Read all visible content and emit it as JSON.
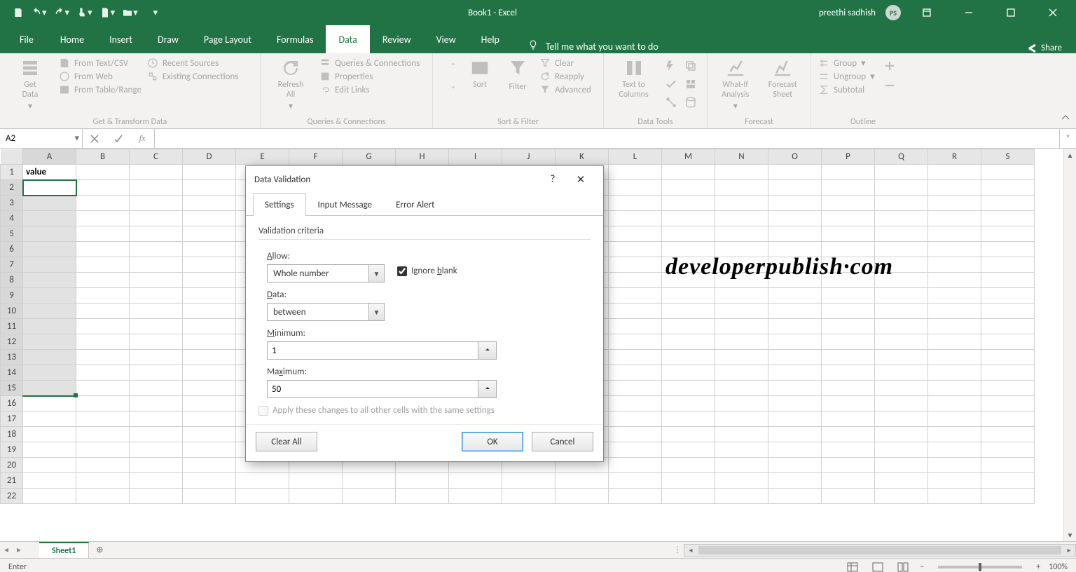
{
  "titlebar": {
    "doc": "Book1",
    "app": "Excel",
    "sep": "  -  ",
    "user": "preethi sadhish",
    "avatar": "PS"
  },
  "tabs": {
    "file": "File",
    "list": [
      "Home",
      "Insert",
      "Draw",
      "Page Layout",
      "Formulas",
      "Data",
      "Review",
      "View",
      "Help"
    ],
    "active": "Data",
    "tellme": "Tell me what you want to do",
    "share": "Share"
  },
  "ribbon": {
    "getdata": {
      "big": "Get\nData",
      "items": [
        "From Text/CSV",
        "From Web",
        "From Table/Range",
        "Recent Sources",
        "Existing Connections"
      ],
      "label": "Get & Transform Data"
    },
    "queries": {
      "big": "Refresh\nAll",
      "items": [
        "Queries & Connections",
        "Properties",
        "Edit Links"
      ],
      "label": "Queries & Connections"
    },
    "sortfilter": {
      "sort": "Sort",
      "filter": "Filter",
      "clear": "Clear",
      "reapply": "Reapply",
      "advanced": "Advanced",
      "label": "Sort & Filter"
    },
    "datatools": {
      "big": "Text to\nColumns",
      "label": "Data Tools"
    },
    "forecast": {
      "whatif": "What-If\nAnalysis",
      "sheet": "Forecast\nSheet",
      "label": "Forecast"
    },
    "outline": {
      "group": "Group",
      "ungroup": "Ungroup",
      "subtotal": "Subtotal",
      "label": "Outline"
    }
  },
  "fbar": {
    "name": "A2",
    "fx": "fx"
  },
  "grid": {
    "cols": [
      "A",
      "B",
      "C",
      "D",
      "E",
      "F",
      "G",
      "H",
      "I",
      "J",
      "K",
      "L",
      "M",
      "N",
      "O",
      "P",
      "Q",
      "R",
      "S"
    ],
    "rows": 22,
    "A1": "value",
    "sel_start": 2,
    "sel_end": 15,
    "watermark": "developerpublish·com"
  },
  "sheetbar": {
    "sheet": "Sheet1"
  },
  "status": {
    "mode": "Enter",
    "zoom": "100%"
  },
  "dialog": {
    "title": "Data Validation",
    "tabs": [
      "Settings",
      "Input Message",
      "Error Alert"
    ],
    "active_tab": "Settings",
    "section": "Validation criteria",
    "allow_label": "Allow:",
    "allow_value": "Whole number",
    "ignore": "Ignore blank",
    "data_label": "Data:",
    "data_value": "between",
    "min_label": "Minimum:",
    "min_value": "1",
    "max_label": "Maximum:",
    "max_value": "50",
    "apply_all": "Apply these changes to all other cells with the same settings",
    "clear": "Clear All",
    "ok": "OK",
    "cancel": "Cancel"
  }
}
